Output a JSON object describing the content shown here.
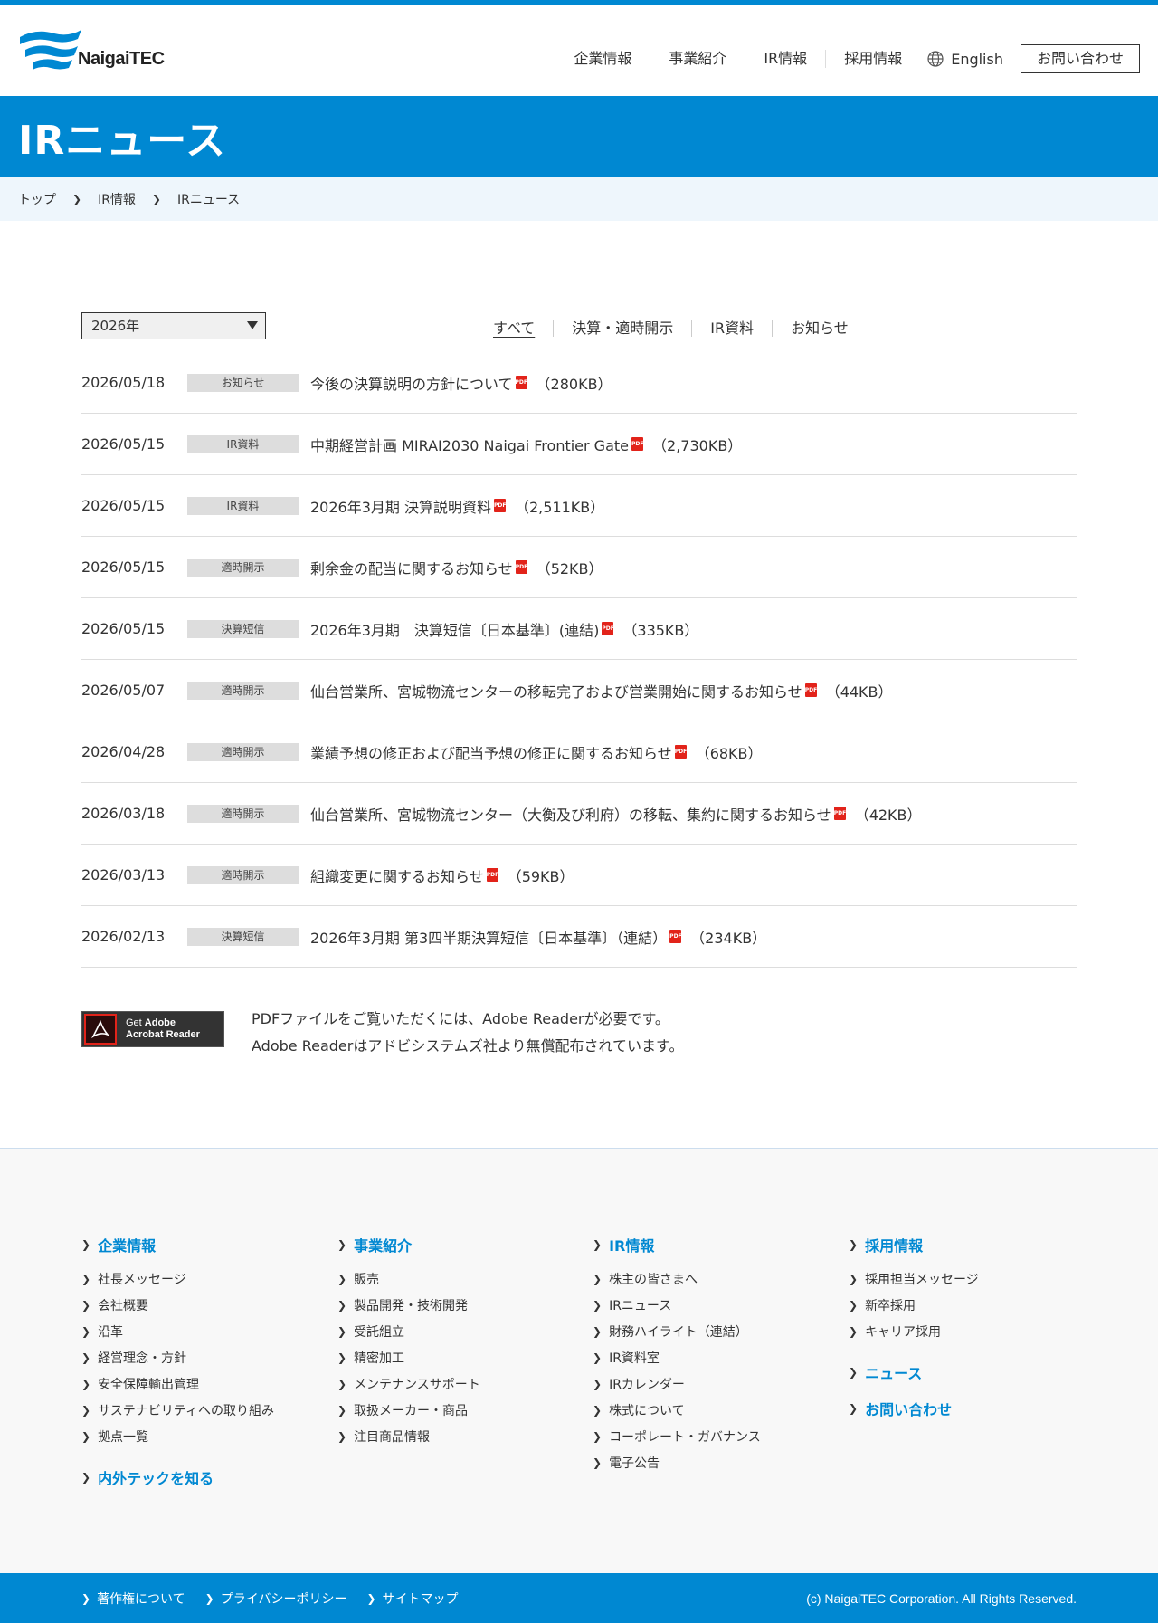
{
  "header": {
    "logo_text": "NaigaiTEC",
    "nav": [
      "企業情報",
      "事業紹介",
      "IR情報",
      "採用情報"
    ],
    "lang": "English",
    "contact": "お問い合わせ"
  },
  "hero": {
    "title": "IRニュース"
  },
  "breadcrumb": {
    "home": "トップ",
    "parent": "IR情報",
    "current": "IRニュース"
  },
  "filter": {
    "year": "2026年",
    "tabs": [
      "すべて",
      "決算・適時開示",
      "IR資料",
      "お知らせ"
    ],
    "active_tab": "すべて"
  },
  "news": [
    {
      "date": "2026/05/18",
      "category": "お知らせ",
      "title": "今後の決算説明の方針について",
      "size": "（280KB）"
    },
    {
      "date": "2026/05/15",
      "category": "IR資料",
      "title": "中期経営計画 MIRAI2030 Naigai Frontier Gate",
      "size": "（2,730KB）"
    },
    {
      "date": "2026/05/15",
      "category": "IR資料",
      "title": "2026年3月期 決算説明資料",
      "size": "（2,511KB）"
    },
    {
      "date": "2026/05/15",
      "category": "適時開示",
      "title": "剰余金の配当に関するお知らせ",
      "size": "（52KB）"
    },
    {
      "date": "2026/05/15",
      "category": "決算短信",
      "title": "2026年3月期　決算短信〔日本基準〕(連結)",
      "size": "（335KB）"
    },
    {
      "date": "2026/05/07",
      "category": "適時開示",
      "title": "仙台営業所、宮城物流センターの移転完了および営業開始に関するお知らせ",
      "size": "（44KB）"
    },
    {
      "date": "2026/04/28",
      "category": "適時開示",
      "title": "業績予想の修正および配当予想の修正に関するお知らせ",
      "size": "（68KB）"
    },
    {
      "date": "2026/03/18",
      "category": "適時開示",
      "title": "仙台営業所、宮城物流センター（大衡及び利府）の移転、集約に関するお知らせ",
      "size": "（42KB）"
    },
    {
      "date": "2026/03/13",
      "category": "適時開示",
      "title": "組織変更に関するお知らせ",
      "size": "（59KB）"
    },
    {
      "date": "2026/02/13",
      "category": "決算短信",
      "title": "2026年3月期 第3四半期決算短信〔日本基準〕（連結）",
      "size": "（234KB）"
    }
  ],
  "pdf_label": "PDF",
  "adobe": {
    "badge_get": "Get",
    "badge_adobe": "Adobe",
    "badge_reader": "Acrobat Reader",
    "line1": "PDFファイルをご覧いただくには、Adobe Readerが必要です。",
    "line2": "Adobe Readerはアドビシステムズ社より無償配布されています。"
  },
  "footer": {
    "columns": [
      {
        "head": "企業情報",
        "items": [
          "社長メッセージ",
          "会社概要",
          "沿革",
          "経営理念・方針",
          "安全保障輸出管理",
          "サステナビリティへの取り組み",
          "拠点一覧"
        ],
        "extra": [
          "内外テックを知る"
        ]
      },
      {
        "head": "事業紹介",
        "items": [
          "販売",
          "製品開発・技術開発",
          "受託組立",
          "精密加工",
          "メンテナンスサポート",
          "取扱メーカー・商品",
          "注目商品情報"
        ],
        "extra": []
      },
      {
        "head": "IR情報",
        "items": [
          "株主の皆さまへ",
          "IRニュース",
          "財務ハイライト（連結）",
          "IR資料室",
          "IRカレンダー",
          "株式について",
          "コーポレート・ガバナンス",
          "電子公告"
        ],
        "extra": []
      },
      {
        "head": "採用情報",
        "items": [
          "採用担当メッセージ",
          "新卒採用",
          "キャリア採用"
        ],
        "extra": [
          "ニュース",
          "お問い合わせ"
        ]
      }
    ],
    "bottom_links": [
      "著作権について",
      "プライバシーポリシー",
      "サイトマップ"
    ],
    "copyright": "(c) NaigaiTEC Corporation. All Rights Reserved."
  },
  "colors": {
    "brand": "#0088d2",
    "pdf": "#e2231a"
  }
}
